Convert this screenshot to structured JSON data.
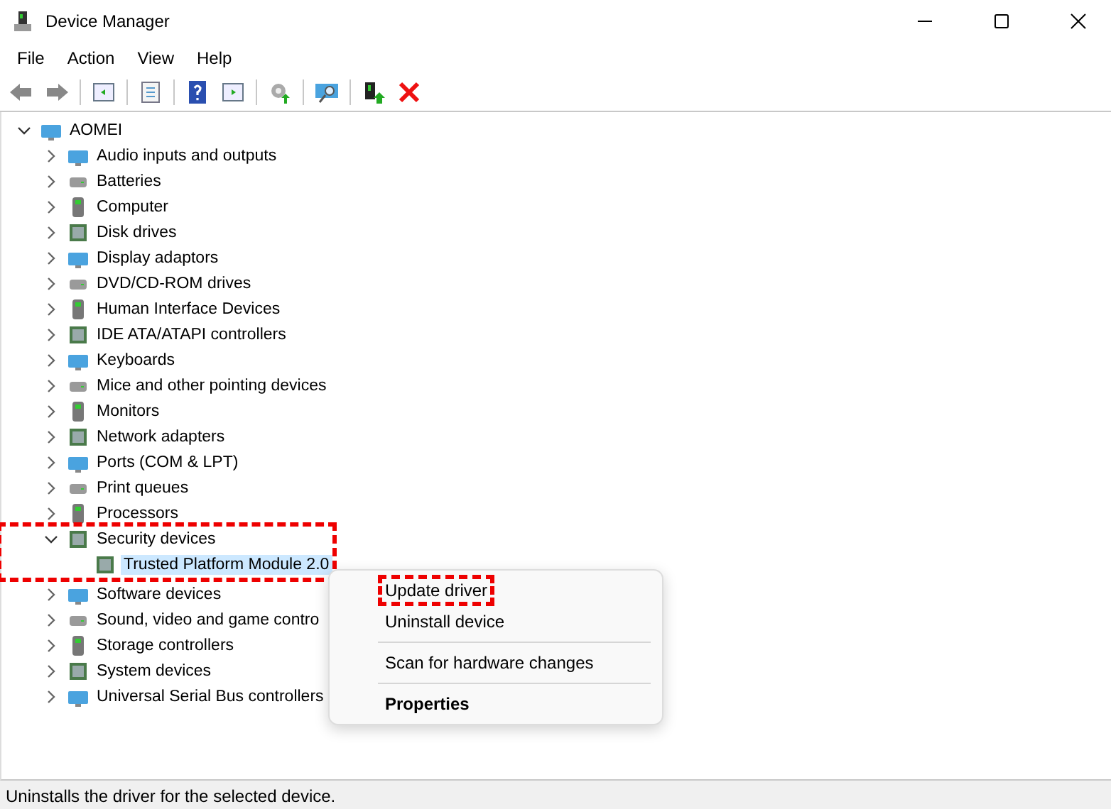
{
  "window": {
    "title": "Device Manager"
  },
  "menu_bar": [
    "File",
    "Action",
    "View",
    "Help"
  ],
  "tree": {
    "label": "AOMEI",
    "expanded": true,
    "selected": false,
    "highlighted": false,
    "children": [
      {
        "label": "Audio inputs and outputs",
        "expanded": false,
        "selected": false,
        "highlighted": false
      },
      {
        "label": "Batteries",
        "expanded": false,
        "selected": false,
        "highlighted": false
      },
      {
        "label": "Computer",
        "expanded": false,
        "selected": false,
        "highlighted": false
      },
      {
        "label": "Disk drives",
        "expanded": false,
        "selected": false,
        "highlighted": false
      },
      {
        "label": "Display adaptors",
        "expanded": false,
        "selected": false,
        "highlighted": false
      },
      {
        "label": "DVD/CD-ROM drives",
        "expanded": false,
        "selected": false,
        "highlighted": false
      },
      {
        "label": "Human Interface Devices",
        "expanded": false,
        "selected": false,
        "highlighted": false
      },
      {
        "label": "IDE ATA/ATAPI controllers",
        "expanded": false,
        "selected": false,
        "highlighted": false
      },
      {
        "label": "Keyboards",
        "expanded": false,
        "selected": false,
        "highlighted": false
      },
      {
        "label": "Mice and other pointing devices",
        "expanded": false,
        "selected": false,
        "highlighted": false
      },
      {
        "label": "Monitors",
        "expanded": false,
        "selected": false,
        "highlighted": false
      },
      {
        "label": "Network adapters",
        "expanded": false,
        "selected": false,
        "highlighted": false
      },
      {
        "label": "Ports (COM & LPT)",
        "expanded": false,
        "selected": false,
        "highlighted": false
      },
      {
        "label": "Print queues",
        "expanded": false,
        "selected": false,
        "highlighted": false
      },
      {
        "label": "Processors",
        "expanded": false,
        "selected": false,
        "highlighted": false
      },
      {
        "label": "Security devices",
        "expanded": true,
        "selected": false,
        "highlighted": true,
        "children": [
          {
            "label": "Trusted Platform Module 2.0",
            "selected": true,
            "highlighted": false
          }
        ]
      },
      {
        "label": "Software devices",
        "expanded": false,
        "selected": false,
        "highlighted": false
      },
      {
        "label": "Sound, video and game contro",
        "expanded": false,
        "selected": false,
        "highlighted": false
      },
      {
        "label": "Storage controllers",
        "expanded": false,
        "selected": false,
        "highlighted": false
      },
      {
        "label": "System devices",
        "expanded": false,
        "selected": false,
        "highlighted": false
      },
      {
        "label": "Universal Serial Bus controllers",
        "expanded": false,
        "selected": false,
        "highlighted": false
      }
    ]
  },
  "context_menu": [
    {
      "kind": "item",
      "label": "Update driver",
      "highlighted": true,
      "default": false
    },
    {
      "kind": "item",
      "label": "Uninstall device",
      "highlighted": false,
      "default": false
    },
    {
      "kind": "separator"
    },
    {
      "kind": "item",
      "label": "Scan for hardware changes",
      "highlighted": false,
      "default": false
    },
    {
      "kind": "separator"
    },
    {
      "kind": "item",
      "label": "Properties",
      "highlighted": false,
      "default": true
    }
  ],
  "status_bar": "Uninstalls the driver for the selected device."
}
